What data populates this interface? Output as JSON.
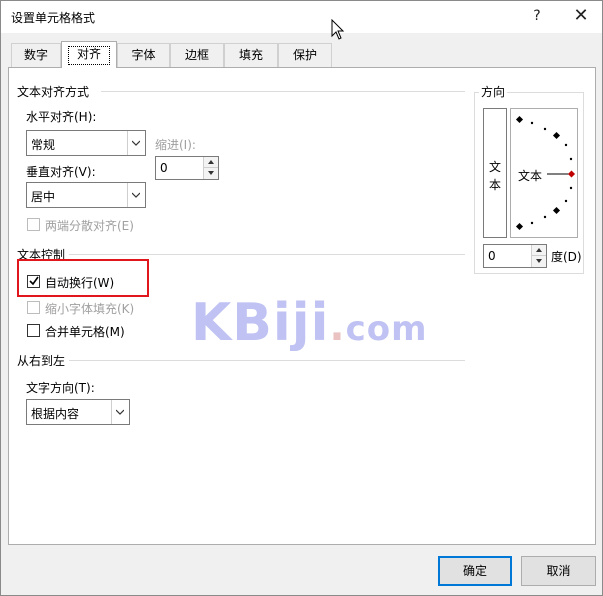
{
  "window": {
    "title": "设置单元格格式",
    "help": "?",
    "close": "✕"
  },
  "tabs": [
    {
      "label": "数字",
      "active": false
    },
    {
      "label": "对齐",
      "active": true
    },
    {
      "label": "字体",
      "active": false
    },
    {
      "label": "边框",
      "active": false
    },
    {
      "label": "填充",
      "active": false
    },
    {
      "label": "保护",
      "active": false
    }
  ],
  "text_alignment": {
    "section_title": "文本对齐方式",
    "horizontal_label": "水平对齐(H):",
    "horizontal_value": "常规",
    "indent_label": "缩进(I):",
    "indent_value": "0",
    "vertical_label": "垂直对齐(V):",
    "vertical_value": "居中",
    "justify_distributed_label": "两端分散对齐(E)"
  },
  "text_control": {
    "section_title": "文本控制",
    "wrap_text_label": "自动换行(W)",
    "wrap_text_checked": true,
    "shrink_to_fit_label": "缩小字体填充(K)",
    "shrink_to_fit_checked": false,
    "merge_cells_label": "合并单元格(M)",
    "merge_cells_checked": false
  },
  "rtl": {
    "section_title": "从右到左",
    "direction_label": "文字方向(T):",
    "direction_value": "根据内容"
  },
  "orientation": {
    "section_title": "方向",
    "vertical_text": [
      "文",
      "本"
    ],
    "dial_text": "文本",
    "degree_value": "0",
    "degree_label": "度(D)"
  },
  "buttons": {
    "ok": "确定",
    "cancel": "取消"
  },
  "watermark": {
    "main": "KBiji",
    "dot": ".",
    "com": "com"
  },
  "colors": {
    "highlight": "#e0161c",
    "primary_button_border": "#0078d7",
    "watermark": "#b4b8f0",
    "dial_marker": "#c00000"
  }
}
